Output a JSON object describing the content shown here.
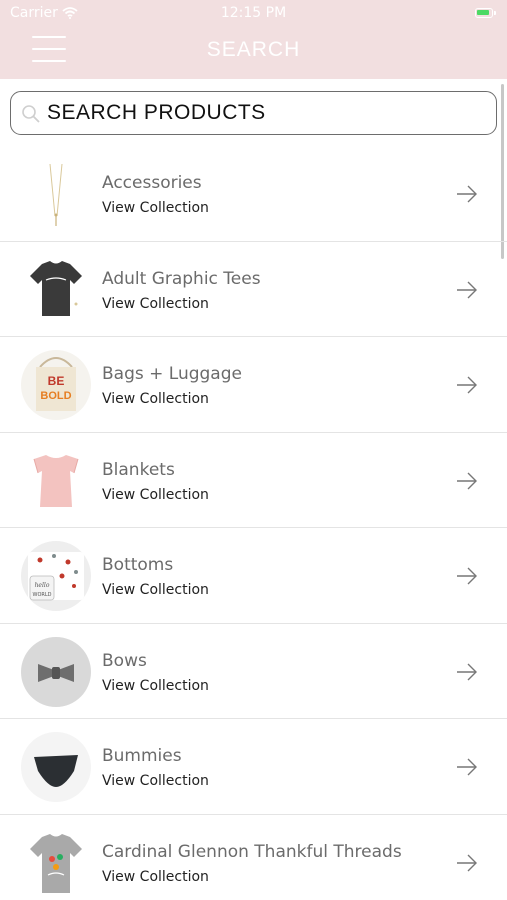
{
  "status_bar": {
    "carrier": "Carrier",
    "time": "12:15 PM",
    "battery_color": "#4cd964"
  },
  "header": {
    "title": "SEARCH",
    "background": "#f2dfe0",
    "menu_icon": "hamburger-menu-icon"
  },
  "search": {
    "placeholder": "SEARCH PRODUCTS",
    "value": ""
  },
  "collections": [
    {
      "title": "Accessories",
      "subtitle": "View Collection",
      "thumb": "necklace"
    },
    {
      "title": "Adult Graphic Tees",
      "subtitle": "View Collection",
      "thumb": "tee-dark"
    },
    {
      "title": "Bags + Luggage",
      "subtitle": "View Collection",
      "thumb": "tote"
    },
    {
      "title": "Blankets",
      "subtitle": "View Collection",
      "thumb": "pink-top"
    },
    {
      "title": "Bottoms",
      "subtitle": "View Collection",
      "thumb": "floral-pants"
    },
    {
      "title": "Bows",
      "subtitle": "View Collection",
      "thumb": "bow"
    },
    {
      "title": "Bummies",
      "subtitle": "View Collection",
      "thumb": "bummies"
    },
    {
      "title": "Cardinal Glennon Thankful Threads",
      "subtitle": "View Collection",
      "thumb": "tee-grey"
    }
  ]
}
